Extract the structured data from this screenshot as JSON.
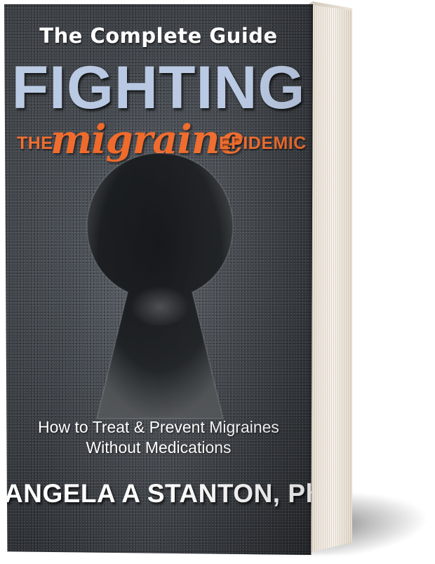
{
  "book": {
    "series_label": "The Complete Guide",
    "title_main": "FIGHTING",
    "title_prefix": "THE",
    "title_highlight": "migraine",
    "title_suffix": "EPIDEMIC",
    "subtitle_line1": "How to Treat & Prevent Migraines",
    "subtitle_line2": "Without Medications",
    "author": "ANGELA A STANTON, Ph.D"
  },
  "colors": {
    "cover_background": "#3f444a",
    "title_main": "#b9c9e3",
    "title_accent": "#ef6a2b",
    "text_white": "#ffffff",
    "page_edges": "#efe8de"
  },
  "icons": {
    "center_graphic": "keyhole-icon"
  }
}
